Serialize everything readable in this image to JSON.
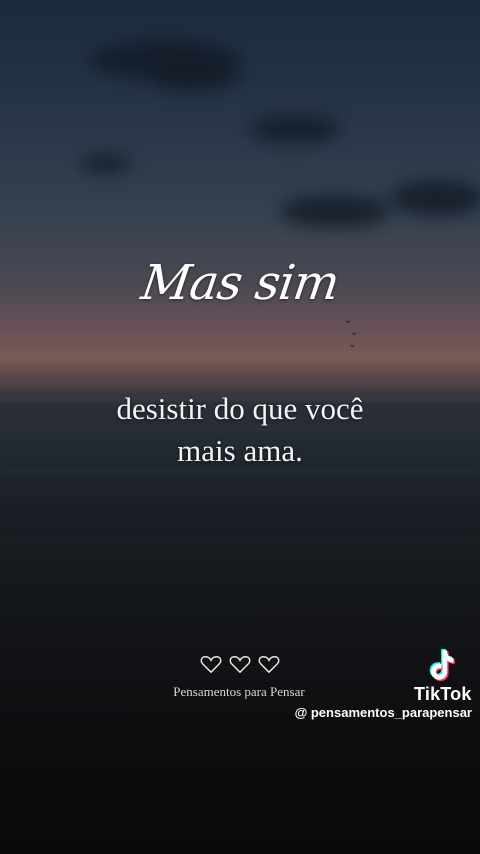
{
  "overlay": {
    "title": "Mas sim",
    "quote_line1": "desistir do que você",
    "quote_line2": "mais ama."
  },
  "footer": {
    "hearts_icon": "three-hearts",
    "brand_name": "Pensamentos para Pensar"
  },
  "watermark": {
    "logo_icon": "tiktok-logo-icon",
    "platform_name": "TikTok",
    "handle": "@ pensamentos_parapensar",
    "colors": {
      "cyan": "#25f4ee",
      "red": "#fe2c55",
      "white": "#ffffff"
    }
  }
}
